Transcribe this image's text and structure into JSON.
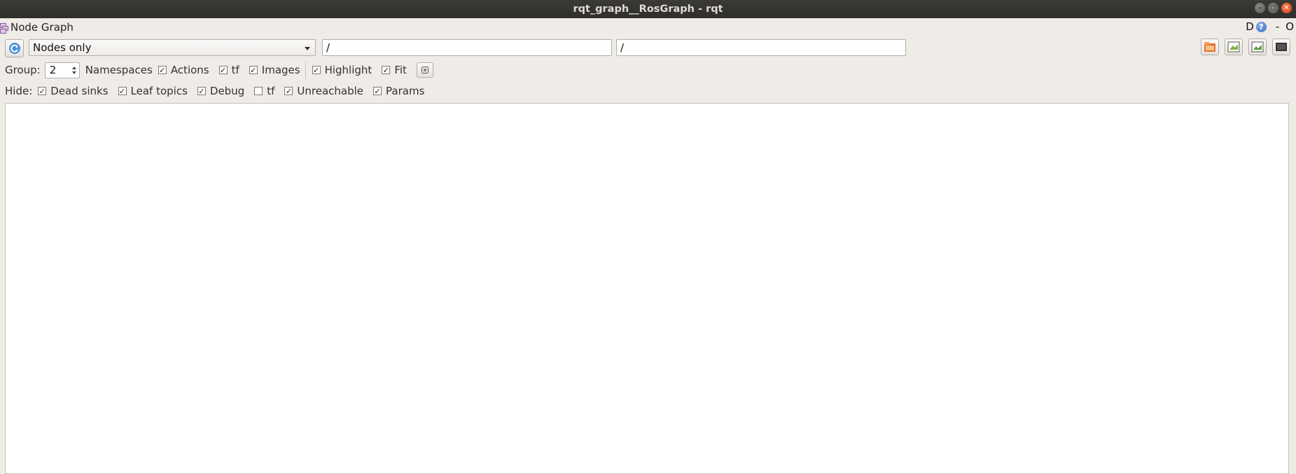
{
  "window": {
    "title": "rqt_graph__RosGraph - rqt",
    "controls": [
      "minimize-icon",
      "maximize-icon",
      "close-icon"
    ]
  },
  "plugin": {
    "title": "Node Graph",
    "right_tools": {
      "d_label": "D",
      "help_label": "?",
      "dash_label": "-",
      "o_label": "O"
    }
  },
  "toolbar": {
    "refresh_icon": "refresh-icon",
    "graph_type": {
      "selected": "Nodes only"
    },
    "node_filter": {
      "value": "/"
    },
    "topic_filter": {
      "value": "/"
    },
    "right_buttons": [
      "load-dot-icon",
      "save-dot-icon",
      "save-image-icon",
      "screenshot-icon"
    ]
  },
  "options": {
    "group_label": "Group:",
    "group_value": "2",
    "namespaces": {
      "label": "Namespaces",
      "checked": true
    },
    "actions": {
      "label": "Actions",
      "checked": true
    },
    "tf": {
      "label": "tf",
      "checked": true
    },
    "images": {
      "label": "Images",
      "checked": true
    },
    "highlight": {
      "label": "Highlight",
      "checked": true
    },
    "fit": {
      "label": "Fit",
      "checked": true
    },
    "fit_button_icon": "fit-in-view-icon"
  },
  "hide": {
    "label": "Hide:",
    "dead_sinks": {
      "label": "Dead sinks",
      "checked": true
    },
    "leaf_topics": {
      "label": "Leaf topics",
      "checked": true
    },
    "debug": {
      "label": "Debug",
      "checked": true
    },
    "tf": {
      "label": "tf",
      "checked": false
    },
    "unreachable": {
      "label": "Unreachable",
      "checked": true
    },
    "params": {
      "label": "Params",
      "checked": true
    }
  },
  "colors": {
    "background": "#efebe7",
    "titlebar": "#34332f",
    "close_button": "#e95420",
    "canvas": "#ffffff"
  }
}
